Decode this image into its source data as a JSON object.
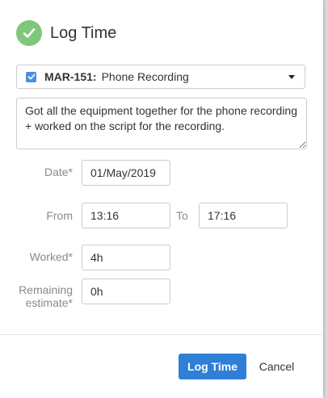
{
  "dialog": {
    "title": "Log Time",
    "icon": "check-circle-icon",
    "accent_color": "#7fc77d"
  },
  "issue": {
    "checked": true,
    "key": "MAR-151:",
    "summary": "Phone Recording"
  },
  "description": {
    "value": "Got all the equipment together for the phone recording + worked on the script for the recording."
  },
  "form": {
    "date_label": "Date*",
    "date_value": "01/May/2019",
    "from_label": "From",
    "from_value": "13:16",
    "to_label": "To",
    "to_value": "17:16",
    "worked_label": "Worked*",
    "worked_value": "4h",
    "remaining_label_line1": "Remaining",
    "remaining_label_line2": "estimate*",
    "remaining_value": "0h"
  },
  "actions": {
    "submit_label": "Log Time",
    "cancel_label": "Cancel",
    "primary_color": "#2f7fd7"
  }
}
